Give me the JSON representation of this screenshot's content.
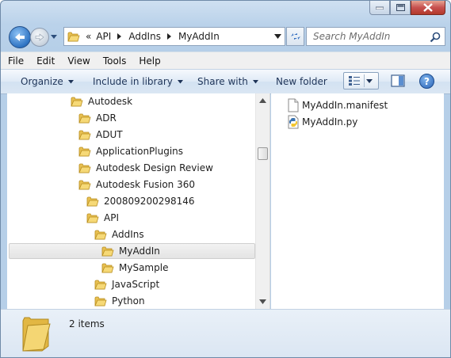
{
  "window": {
    "caption_buttons": [
      "minimize",
      "maximize",
      "close"
    ]
  },
  "navigation": {
    "breadcrumb_prefix": "«",
    "breadcrumb": [
      "API",
      "AddIns",
      "MyAddIn"
    ],
    "search_placeholder": "Search MyAddIn"
  },
  "menu": [
    "File",
    "Edit",
    "View",
    "Tools",
    "Help"
  ],
  "commands": {
    "organize": "Organize",
    "include_in_library": "Include in library",
    "share_with": "Share with",
    "new_folder": "New folder",
    "help_label": "?"
  },
  "tree": {
    "items": [
      {
        "label": "Autodesk"
      },
      {
        "label": "ADR"
      },
      {
        "label": "ADUT"
      },
      {
        "label": "ApplicationPlugins"
      },
      {
        "label": "Autodesk Design Review"
      },
      {
        "label": "Autodesk Fusion 360"
      },
      {
        "label": "200809200298146"
      },
      {
        "label": "API"
      },
      {
        "label": "AddIns"
      },
      {
        "label": "MyAddIn",
        "selected": true
      },
      {
        "label": "MySample"
      },
      {
        "label": "JavaScript"
      },
      {
        "label": "Python"
      }
    ]
  },
  "files": [
    {
      "name": "MyAddIn.manifest",
      "icon": "document-icon"
    },
    {
      "name": "MyAddIn.py",
      "icon": "python-file-icon"
    }
  ],
  "status": {
    "item_count": "2 items"
  },
  "colors": {
    "folder": "#e8c052",
    "command_text": "#1e3458",
    "close_red": "#c75050"
  }
}
